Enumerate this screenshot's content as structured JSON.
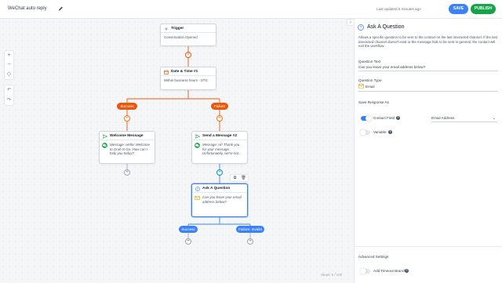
{
  "header": {
    "workflow_name": "WeChat auto reply",
    "last_updated": "Last updated 5 minutes ago",
    "save_label": "SAVE",
    "publish_label": "PUBLISH"
  },
  "canvas": {
    "zoom_in": "+",
    "zoom_out": "−",
    "fit": "◇",
    "undo": "↶",
    "redo": "↷",
    "steps_indicator": "Steps: 6 / 100",
    "trigger": {
      "title": "Trigger",
      "body": "Conversation Opened"
    },
    "datetime": {
      "title": "Date & Time #1",
      "body": "Within business hours - UTC"
    },
    "branch_labels": [
      "Success",
      "Failure"
    ],
    "welcome": {
      "title": "Welcome Message",
      "message": "Message: Hello! Welcome to Grab N Go. How can I help you today?"
    },
    "send_message": {
      "title": "Send a Message #2",
      "message": "Message: Hi! Thank you for your message. Unfortunately, we're not..."
    },
    "ask_question": {
      "title": "Ask A Question",
      "message": "Can you leave your email address below?"
    },
    "ask_branch_labels": [
      "Success",
      "Failure: Invalid"
    ],
    "copy_icon": "⧉",
    "delete_icon": "🗑"
  },
  "panel": {
    "collapse_icon": "›",
    "title": "Ask A Question",
    "description": "Allows a specific question to be sent to the contact on the last interacted channel. If the last interacted channel doesn't exist or the message fails to be sent in general, the contact will exit the workflow.",
    "question_text_label": "Question Text",
    "question_text_value": "Can you leave your email address below?",
    "question_type_label": "Question Type",
    "question_type_value": "Email",
    "save_response_label": "Save Response As",
    "contact_field_label": "Contact Field",
    "contact_field_value": "Email Address",
    "variable_label": "Variable",
    "advanced_label": "Advanced Settings",
    "timeout_label": "Add Timeout Branch",
    "help_glyph": "?"
  },
  "colors": {
    "accent": "#3b82f6",
    "publish": "#16a34a",
    "branch_orange": "#ea580c",
    "edge_blue": "#3b82f6"
  }
}
